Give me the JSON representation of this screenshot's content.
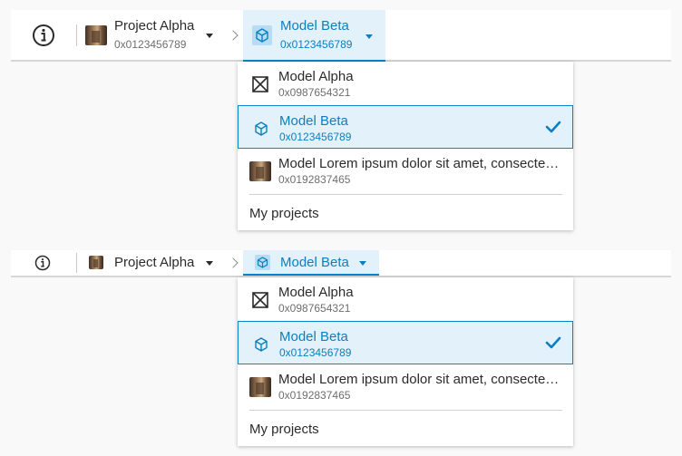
{
  "colors": {
    "accent": "#0a7fc1",
    "accent_bg": "#e3f1fb",
    "bar_bg": "#ffffff",
    "page_bg": "#f9f9f9"
  },
  "variants": [
    {
      "project": {
        "name": "Project Alpha",
        "id": "0x0123456789",
        "icon": "project-thumbnail"
      },
      "active_model": {
        "name": "Model Beta",
        "id": "0x0123456789",
        "icon": "cube-icon"
      },
      "menu": {
        "items": [
          {
            "name": "Model Alpha",
            "id": "0x0987654321",
            "icon": "no-image-icon",
            "selected": false
          },
          {
            "name": "Model Beta",
            "id": "0x0123456789",
            "icon": "cube-icon",
            "selected": true
          },
          {
            "name": "Model Lorem ipsum dolor sit amet, consectetur adipiscing elit",
            "id": "0x0192837465",
            "icon": "model-thumbnail",
            "selected": false
          }
        ],
        "footer_link": "My projects"
      }
    },
    {
      "project": {
        "name": "Project Alpha",
        "icon": "project-thumbnail"
      },
      "active_model": {
        "name": "Model Beta",
        "icon": "cube-icon"
      },
      "menu": {
        "items": [
          {
            "name": "Model Alpha",
            "id": "0x0987654321",
            "icon": "no-image-icon",
            "selected": false
          },
          {
            "name": "Model Beta",
            "id": "0x0123456789",
            "icon": "cube-icon",
            "selected": true
          },
          {
            "name": "Model Lorem ipsum dolor sit amet, consectetur adipiscing elit",
            "id": "0x0192837465",
            "icon": "model-thumbnail",
            "selected": false
          }
        ],
        "footer_link": "My projects"
      }
    }
  ]
}
